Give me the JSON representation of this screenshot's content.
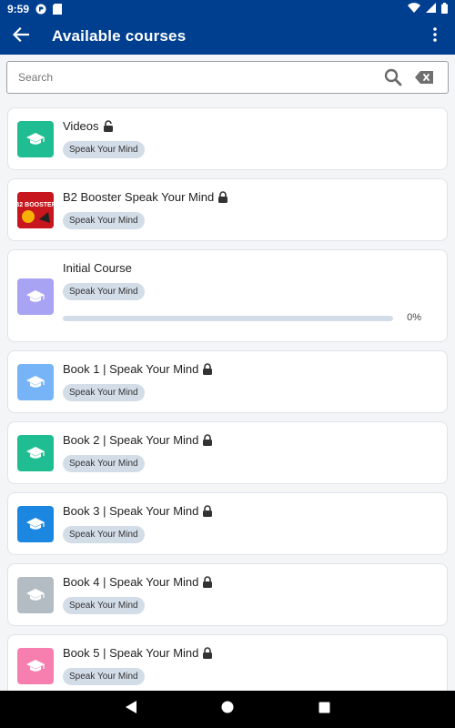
{
  "status_bar": {
    "time": "9:59",
    "icons": [
      "sync-icon",
      "sd-card-icon",
      "wifi-icon",
      "signal-icon",
      "battery-icon"
    ]
  },
  "app_bar": {
    "title": "Available courses",
    "back_icon": "arrow-left-icon",
    "menu_icon": "more-vertical-icon"
  },
  "search": {
    "placeholder": "Search",
    "value": ""
  },
  "courses": [
    {
      "title": "Videos",
      "tag": "Speak Your Mind",
      "lock": "unlocked",
      "thumb": "graduation-cap-icon",
      "thumb_color": "#1fbd91"
    },
    {
      "title": "B2 Booster Speak Your Mind",
      "tag": "Speak Your Mind",
      "lock": "locked",
      "thumb": "booster-cover-image",
      "thumb_color": "#c7161d",
      "thumb_text": "B2 BOOSTER"
    },
    {
      "title": "Initial Course",
      "tag": "Speak Your Mind",
      "lock": "none",
      "thumb": "graduation-cap-icon",
      "thumb_color": "#a8a3f2",
      "progress": 0,
      "progress_text": "0%"
    },
    {
      "title": "Book 1 | Speak Your Mind",
      "tag": "Speak Your Mind",
      "lock": "locked",
      "thumb": "graduation-cap-icon",
      "thumb_color": "#76b4f7"
    },
    {
      "title": "Book 2 | Speak Your Mind",
      "tag": "Speak Your Mind",
      "lock": "locked",
      "thumb": "graduation-cap-icon",
      "thumb_color": "#1fbd91"
    },
    {
      "title": "Book 3 | Speak Your Mind",
      "tag": "Speak Your Mind",
      "lock": "locked",
      "thumb": "graduation-cap-icon",
      "thumb_color": "#1b87e0"
    },
    {
      "title": "Book 4 | Speak Your Mind",
      "tag": "Speak Your Mind",
      "lock": "locked",
      "thumb": "graduation-cap-icon",
      "thumb_color": "#b3bcc3"
    },
    {
      "title": "Book 5 | Speak Your Mind",
      "tag": "Speak Your Mind",
      "lock": "locked",
      "thumb": "graduation-cap-icon",
      "thumb_color": "#f77fb0"
    }
  ],
  "nav_bar": {
    "buttons": [
      "back-triangle-icon",
      "home-circle-icon",
      "recents-square-icon"
    ]
  }
}
